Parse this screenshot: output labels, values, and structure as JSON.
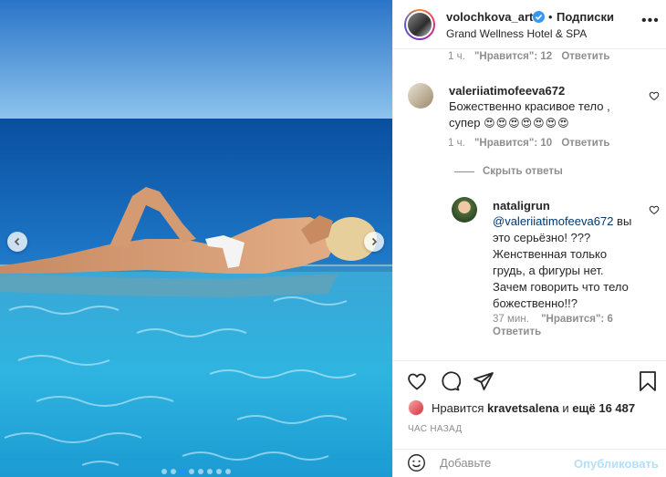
{
  "post": {
    "carousel_total": 8,
    "carousel_active": 2
  },
  "header": {
    "username": "volochkova_art",
    "separator": "•",
    "follow_label": "Подписки",
    "location": "Grand Wellness Hotel & SPA",
    "more_icon": "more-horizontal-icon"
  },
  "comments": {
    "top_partial": {
      "time": "1 ч.",
      "likes": "\"Нравится\": 12",
      "reply": "Ответить"
    },
    "items": [
      {
        "username": "valeriiatimofeeva672",
        "text_line1": "Божественно красивое тело ,",
        "text_line2": "супер",
        "emoji": "😍😍😍😍😍😍😍",
        "time": "1 ч.",
        "likes": "\"Нравится\": 10",
        "reply": "Ответить"
      }
    ],
    "hide_replies": "Скрыть ответы",
    "reply_item": {
      "username": "nataligrun",
      "mention": "@valeriiatimofeeva672",
      "text_after_mention": " вы",
      "lines": [
        "это серьёзно! ???",
        "Женственная только",
        "грудь, а фигуры нет.",
        "Зачем говорить что тело",
        "божественно!!?"
      ],
      "time": "37 мин.",
      "likes": "\"Нравится\": 6",
      "reply": "Ответить"
    }
  },
  "actions": {
    "likes_prefix": "Нравится",
    "likes_user": "kravetsalena",
    "likes_mid": "и",
    "likes_count": "ещё 16 487",
    "time_ago": "ЧАС НАЗАД"
  },
  "composer": {
    "placeholder": "Добавьте комментарий...",
    "placeholder_visible": "Добавьте",
    "publish_label": "Опубликовать"
  },
  "colors": {
    "accent": "#0095f6",
    "publish_disabled": "#b2dffc",
    "muted": "#8e8e8e",
    "mention": "#00376b"
  }
}
